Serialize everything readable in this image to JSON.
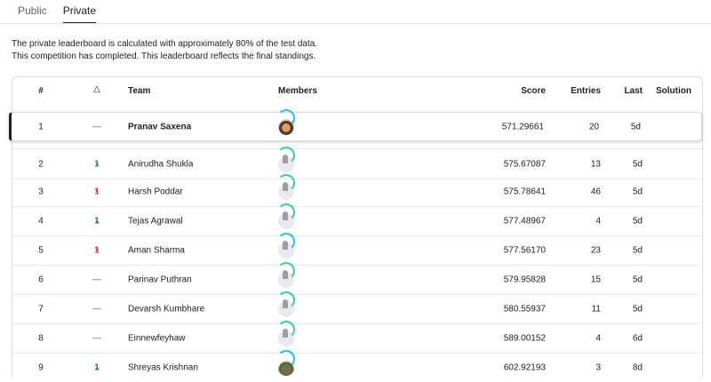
{
  "tabs": {
    "public": "Public",
    "private": "Private"
  },
  "notice": {
    "line1": "The private leaderboard is calculated with approximately 80% of the test data.",
    "line2": "This competition has completed. This leaderboard reflects the final standings."
  },
  "headers": {
    "rank": "#",
    "delta": "△",
    "team": "Team",
    "members": "Members",
    "score": "Score",
    "entries": "Entries",
    "last": "Last",
    "solution": "Solution"
  },
  "rows": [
    {
      "rank": "1",
      "delta": "—",
      "team": "Pranav Saxena",
      "score": "571.29661",
      "entries": "20",
      "last": "5d"
    },
    {
      "rank": "2",
      "delta": "1",
      "team": "Anirudha Shukla",
      "score": "575.67087",
      "entries": "13",
      "last": "5d"
    },
    {
      "rank": "3",
      "delta": "1",
      "team": "Harsh Poddar",
      "score": "575.78641",
      "entries": "46",
      "last": "5d"
    },
    {
      "rank": "4",
      "delta": "1",
      "team": "Tejas Agrawal",
      "score": "577.48967",
      "entries": "4",
      "last": "5d"
    },
    {
      "rank": "5",
      "delta": "1",
      "team": "Aman Sharma",
      "score": "577.56170",
      "entries": "23",
      "last": "5d"
    },
    {
      "rank": "6",
      "delta": "—",
      "team": "Parinav Puthran",
      "score": "579.95828",
      "entries": "15",
      "last": "5d"
    },
    {
      "rank": "7",
      "delta": "—",
      "team": "Devarsh Kumbhare",
      "score": "580.55937",
      "entries": "11",
      "last": "5d"
    },
    {
      "rank": "8",
      "delta": "—",
      "team": "Einnewfeyhaw",
      "score": "589.00152",
      "entries": "4",
      "last": "6d"
    },
    {
      "rank": "9",
      "delta": "1",
      "team": "Shreyas Krishnan",
      "score": "602.92193",
      "entries": "3",
      "last": "8d"
    }
  ],
  "colors": {
    "up": "#1e8e3e",
    "down": "#d93025",
    "accent": "#20beff"
  }
}
